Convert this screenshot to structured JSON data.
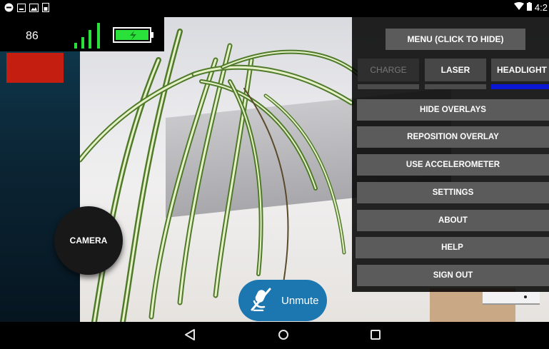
{
  "status_bar": {
    "time_label": "4:2",
    "left_icons": [
      "record-icon",
      "image-icon",
      "gallery-icon",
      "battery-saver-icon"
    ],
    "right_icons": [
      "wifi-icon",
      "battery-icon"
    ]
  },
  "hud": {
    "speed": "86",
    "signal_bars": 4,
    "battery_state": "charging",
    "accent_colors": {
      "signal": "#2ae03a",
      "battery": "#2ae03a",
      "warning": "#c41e10"
    }
  },
  "camera_button": {
    "label": "CAMERA"
  },
  "menu": {
    "toggle_label": "MENU (CLICK TO HIDE)",
    "tabs": [
      {
        "label": "CHARGE",
        "enabled": false,
        "active": false
      },
      {
        "label": "LASER",
        "enabled": true,
        "active": false
      },
      {
        "label": "HEADLIGHT",
        "enabled": true,
        "active": true
      }
    ],
    "active_color": "#0a18d6",
    "items": [
      {
        "label": "HIDE OVERLAYS"
      },
      {
        "label": "REPOSITION OVERLAY"
      },
      {
        "label": "USE ACCELEROMETER"
      },
      {
        "label": "SETTINGS"
      },
      {
        "label": "ABOUT"
      },
      {
        "label": "HELP"
      },
      {
        "label": "SIGN OUT"
      }
    ]
  },
  "unmute": {
    "label": "Unmute",
    "color": "#1c76b0"
  },
  "nav_bar": {
    "buttons": [
      "back-icon",
      "home-icon",
      "recents-icon"
    ]
  }
}
